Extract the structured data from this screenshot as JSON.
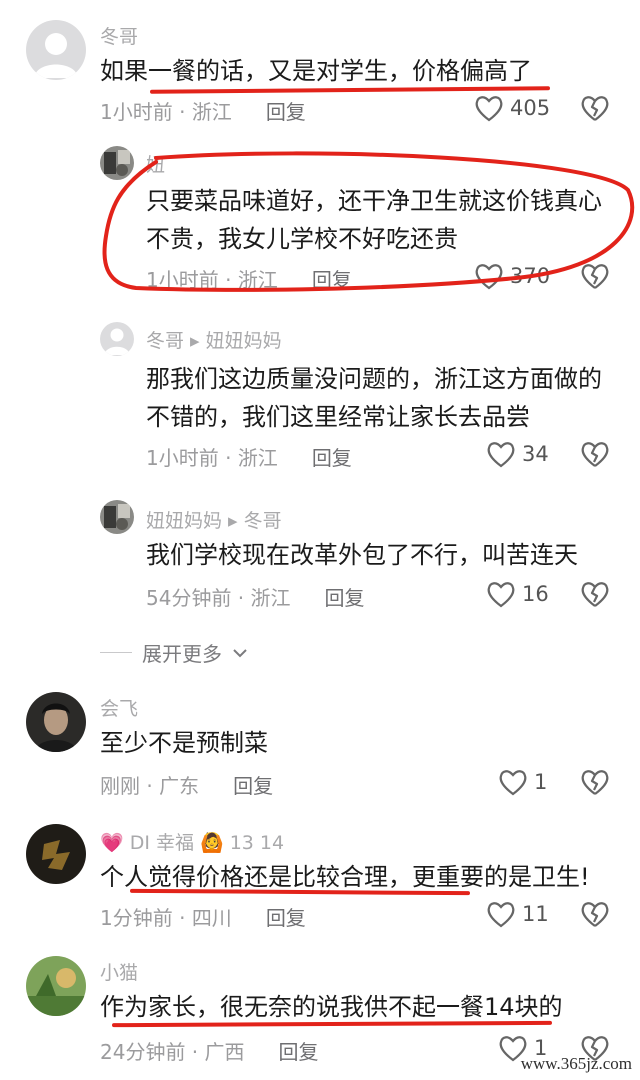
{
  "colors": {
    "annotation": "#e2231a",
    "muted": "#9b9b9d"
  },
  "comments": [
    {
      "user": "冬哥",
      "text": [
        "如果一餐的话，又是对学生，价格偏高了"
      ],
      "time": "1小时前",
      "loc": "浙江",
      "reply": "回复",
      "likes": "405",
      "avatar_icon": "default-avatar-icon"
    },
    {
      "user": "妞",
      "text": [
        "只要菜品味道好，还干净卫生就这价钱真心",
        "不贵，我女儿学校不好吃还贵"
      ],
      "time": "1小时前",
      "loc": "浙江",
      "reply": "回复",
      "likes": "370",
      "avatar_icon": "photo-avatar-icon"
    },
    {
      "user": "冬哥 ▸ 妞妞妈妈",
      "text": [
        "那我们这边质量没问题的，浙江这方面做的",
        "不错的，我们这里经常让家长去品尝"
      ],
      "time": "1小时前",
      "loc": "浙江",
      "reply": "回复",
      "likes": "34",
      "avatar_icon": "default-avatar-icon"
    },
    {
      "user": "妞妞妈妈 ▸ 冬哥",
      "text": [
        "我们学校现在改革外包了不行，叫苦连天"
      ],
      "time": "54分钟前",
      "loc": "浙江",
      "reply": "回复",
      "likes": "16",
      "avatar_icon": "photo-avatar-icon"
    },
    {
      "user": "会飞",
      "text": [
        "至少不是预制菜"
      ],
      "time": "刚刚",
      "loc": "广东",
      "reply": "回复",
      "likes": "1",
      "avatar_icon": "portrait-avatar-icon"
    },
    {
      "user": "💗 ⅮⅠ 幸福 🙆 13 14",
      "text": [
        "个人觉得价格还是比较合理，更重要的是卫生!"
      ],
      "time": "1分钟前",
      "loc": "四川",
      "reply": "回复",
      "likes": "11",
      "avatar_icon": "dark-avatar-icon"
    },
    {
      "user": "小猫",
      "text": [
        "作为家长，很无奈的说我供不起一餐14块的"
      ],
      "time": "24分钟前",
      "loc": "广西",
      "reply": "回复",
      "likes": "1",
      "avatar_icon": "nature-avatar-icon"
    }
  ],
  "expand_more": "展开更多",
  "watermark": "www.365jz.com"
}
